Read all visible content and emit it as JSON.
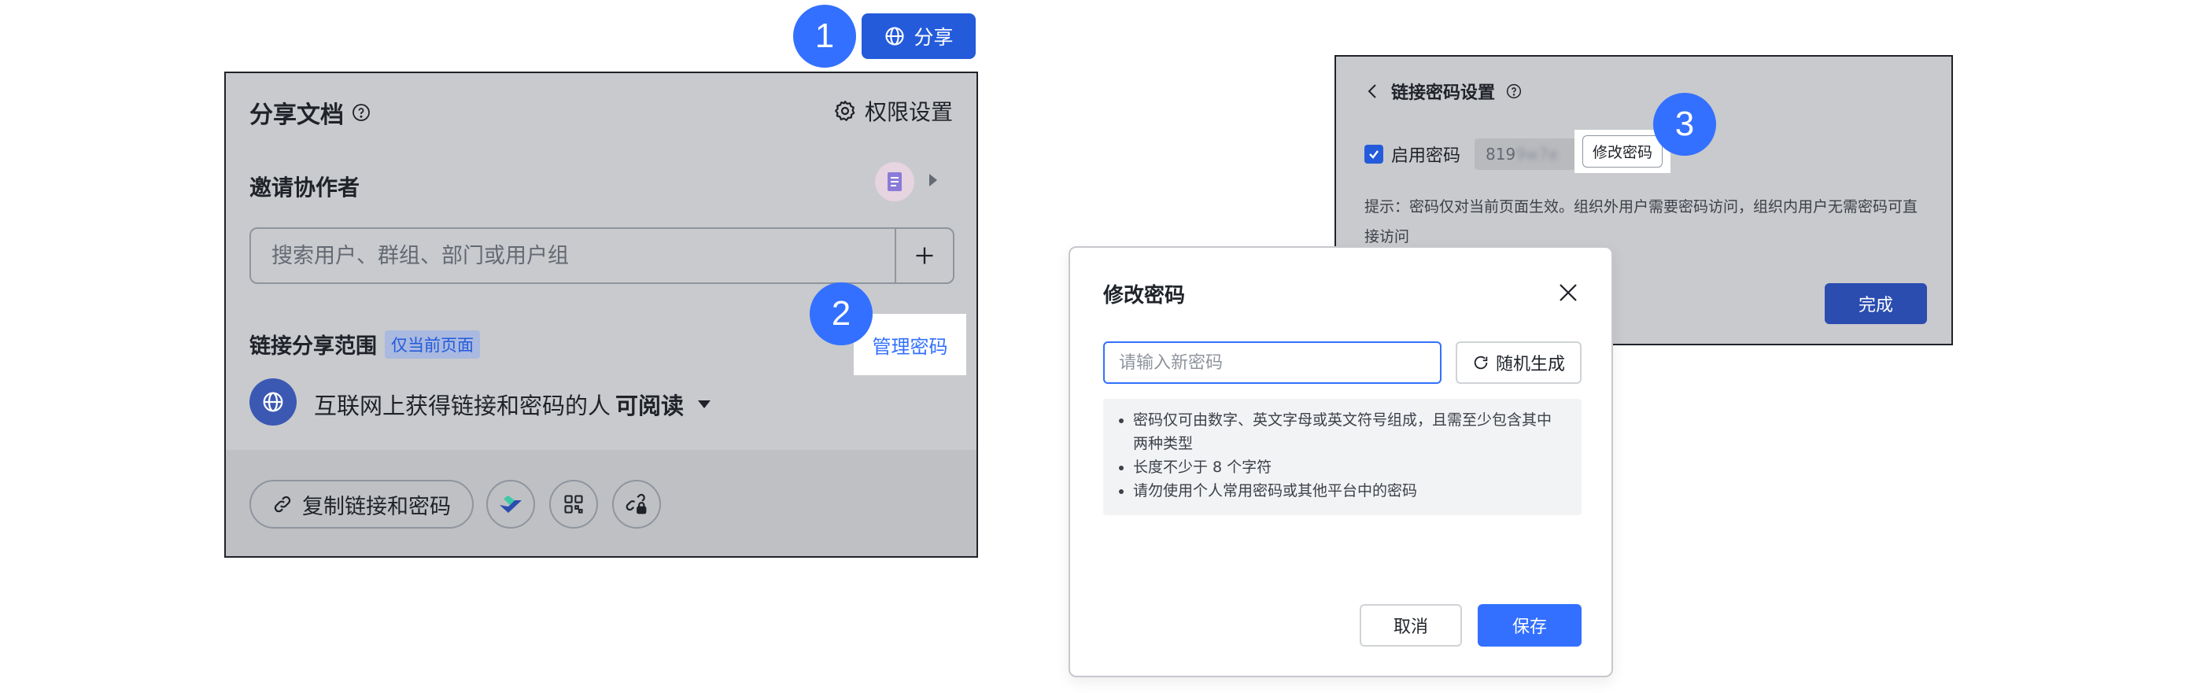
{
  "share_button": {
    "label": "分享",
    "badge": "1"
  },
  "share_panel": {
    "title": "分享文档",
    "permission_settings": "权限设置",
    "invite_title": "邀请协作者",
    "search_placeholder": "搜索用户、群组、部门或用户组",
    "add_icon": "plus-icon",
    "link_scope_title": "链接分享范围",
    "scope_tag": "仅当前页面",
    "manage_password": "管理密码",
    "manage_badge": "2",
    "permission_text": "互联网上获得链接和密码的人",
    "permission_level": "可阅读",
    "copy_link_label": "复制链接和密码",
    "footer_icons": [
      "lark-share-icon",
      "qrcode-icon",
      "link-lock-icon"
    ]
  },
  "password_settings": {
    "title": "链接密码设置",
    "enable_label": "启用密码",
    "enabled": true,
    "password_prefix": "819",
    "password_masked": "9w7e",
    "modify_label": "修改密码",
    "badge": "3",
    "tip": "提示：密码仅对当前页面生效。组织外用户需要密码访问，组织内用户无需密码可直接访问",
    "done_label": "完成"
  },
  "modify_dialog": {
    "title": "修改密码",
    "input_placeholder": "请输入新密码",
    "random_label": "随机生成",
    "rules": [
      "密码仅可由数字、英文字母或英文符号组成，且需至少包含其中两种类型",
      "长度不少于 8 个字符",
      "请勿使用个人常用密码或其他平台中的密码"
    ],
    "cancel_label": "取消",
    "save_label": "保存"
  },
  "colors": {
    "primary": "#3370ff",
    "primary_dark": "#245bdb",
    "overlay_gray": "#c9cacd"
  }
}
